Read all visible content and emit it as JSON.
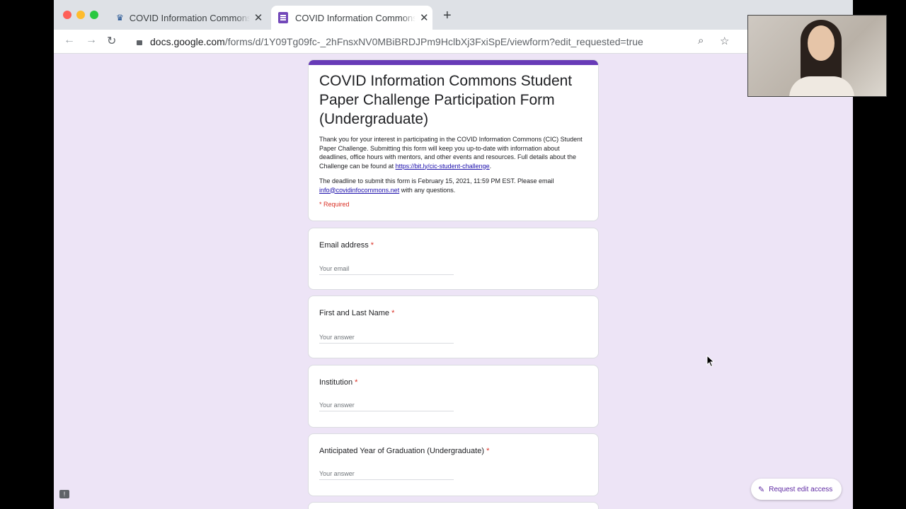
{
  "browser": {
    "tabs": [
      {
        "title": "COVID Information Commons Student Paper Challenge",
        "icon": "university-crown-icon",
        "active": false
      },
      {
        "title": "COVID Information Commons Student Paper Challenge",
        "icon": "google-forms-icon",
        "active": true
      }
    ],
    "url": {
      "domain": "docs.google.com",
      "path": "/forms/d/1Y09Tg09fc-_2hFnsxNV0MBiBRDJPm9HclbXj3FxiSpE/viewform?edit_requested=true"
    }
  },
  "form": {
    "accent_color": "#673ab7",
    "title": "COVID Information Commons Student Paper Challenge Participation Form (Undergraduate)",
    "description_1": "Thank you for your interest in participating in the COVID Information Commons (CIC) Student Paper Challenge. Submitting this form will keep you up-to-date with information about deadlines, office hours with mentors, and other events and resources. Full details about the Challenge can be found at ",
    "description_link": "https://bit.ly/cic-student-challenge",
    "description_1_end": ".",
    "description_2": "The deadline to submit this form is February 15, 2021, 11:59 PM EST. Please email ",
    "email_link": "info@covidinfocommons.net",
    "description_2_end": " with any questions.",
    "required_note": "* Required",
    "questions": [
      {
        "label": "Email address",
        "placeholder": "Your email"
      },
      {
        "label": "First and Last Name",
        "placeholder": "Your answer"
      },
      {
        "label": "Institution",
        "placeholder": "Your answer"
      },
      {
        "label": "Anticipated Year of Graduation (Undergraduate)",
        "placeholder": "Your answer"
      }
    ],
    "required_star": "*"
  },
  "actions": {
    "request_edit_access": "Request edit access"
  }
}
